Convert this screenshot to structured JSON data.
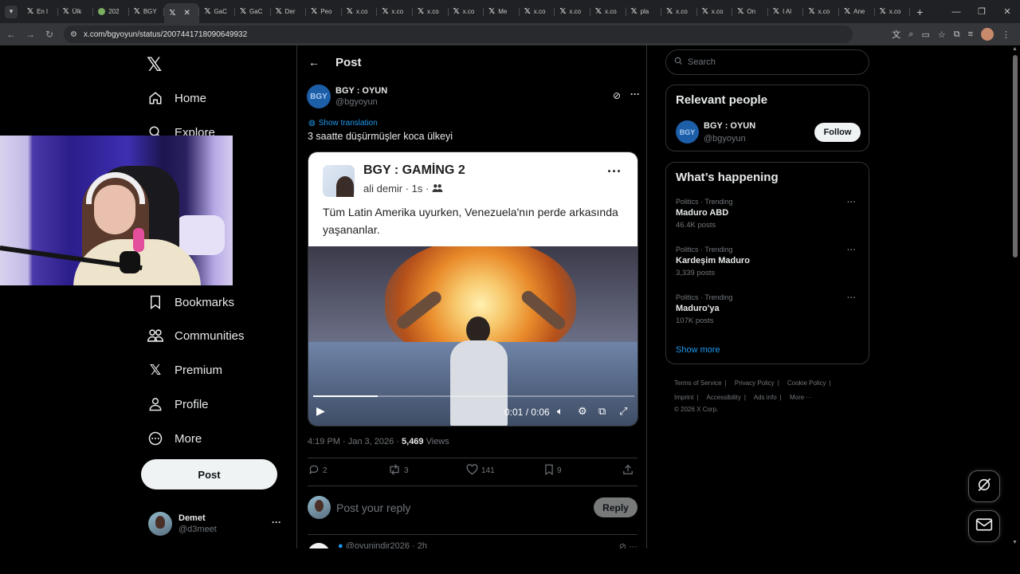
{
  "browser": {
    "tabs": [
      {
        "label": "En l",
        "icon": "x-icon"
      },
      {
        "label": "Ülk",
        "icon": "x-icon"
      },
      {
        "label": "202",
        "icon": "globe-icon"
      },
      {
        "label": "BGY",
        "icon": "x-icon"
      },
      {
        "label": "",
        "icon": "x-icon",
        "active": true
      },
      {
        "label": "GaC",
        "icon": "x-icon"
      },
      {
        "label": "GaC",
        "icon": "x-icon"
      },
      {
        "label": "Der",
        "icon": "x-icon"
      },
      {
        "label": "Peo",
        "icon": "x-icon"
      },
      {
        "label": "x.co",
        "icon": "x-icon"
      },
      {
        "label": "x.co",
        "icon": "x-icon"
      },
      {
        "label": "x.co",
        "icon": "x-icon"
      },
      {
        "label": "x.co",
        "icon": "x-icon"
      },
      {
        "label": "Me",
        "icon": "x-icon"
      },
      {
        "label": "x.co",
        "icon": "x-icon"
      },
      {
        "label": "x.co",
        "icon": "x-icon"
      },
      {
        "label": "x.co",
        "icon": "x-icon"
      },
      {
        "label": "pla",
        "icon": "x-icon"
      },
      {
        "label": "x.co",
        "icon": "x-icon"
      },
      {
        "label": "x.co",
        "icon": "x-icon"
      },
      {
        "label": "On",
        "icon": "x-icon"
      },
      {
        "label": "I Al",
        "icon": "x-icon"
      },
      {
        "label": "x.co",
        "icon": "x-icon"
      },
      {
        "label": "Ane",
        "icon": "x-icon"
      },
      {
        "label": "x.co",
        "icon": "x-icon"
      }
    ],
    "url": "x.com/bgyoyun/status/2007441718090649932"
  },
  "nav": {
    "items": [
      {
        "label": "Home",
        "icon": "home-icon"
      },
      {
        "label": "Explore",
        "icon": "search-icon"
      },
      {
        "label": "ns",
        "icon": "bell-icon"
      },
      {
        "label": "Bookmarks",
        "icon": "bookmark-icon"
      },
      {
        "label": "Communities",
        "icon": "communities-icon"
      },
      {
        "label": "Premium",
        "icon": "x-premium-icon"
      },
      {
        "label": "Profile",
        "icon": "person-icon"
      },
      {
        "label": "More",
        "icon": "more-circle-icon"
      }
    ],
    "post_label": "Post",
    "me": {
      "name": "Demet",
      "handle": "@d3meet"
    }
  },
  "main": {
    "header_title": "Post",
    "author": {
      "name": "BGY : OYUN",
      "handle": "@bgyoyun",
      "avatar_text": "BGY"
    },
    "show_translation": "Show translation",
    "text": "3 saatte düşürmüşler koca ülkeyi",
    "card": {
      "name": "BGY : GAMİNG 2",
      "meta": "ali demir · 1s ·",
      "text": "Tüm Latin Amerika uyurken, Venezuela'nın perde arkasında yaşananlar."
    },
    "video": {
      "time": "0:01 / 0:06",
      "progress": 0.2
    },
    "meta_time": "4:19 PM · Jan 3, 2026 ·",
    "views_count": "5,469",
    "views_label": "Views",
    "actions": {
      "replies": "2",
      "reposts": "3",
      "likes": "141",
      "bookmarks": "9"
    },
    "reply_placeholder": "Post your reply",
    "reply_button": "Reply",
    "next_post": {
      "handle": "@oyunindir2026 · 2h"
    }
  },
  "right": {
    "search_placeholder": "Search",
    "relevant_title": "Relevant people",
    "relevant_person": {
      "name": "BGY : OYUN",
      "handle": "@bgyoyun",
      "avatar_text": "BGY",
      "follow": "Follow"
    },
    "happening_title": "What’s happening",
    "trends": [
      {
        "category": "Politics · Trending",
        "name": "Maduro ABD",
        "count": "46.4K posts"
      },
      {
        "category": "Politics · Trending",
        "name": "Kardeşim Maduro",
        "count": "3,339 posts"
      },
      {
        "category": "Politics · Trending",
        "name": "Maduro'ya",
        "count": "107K posts"
      }
    ],
    "show_more": "Show more",
    "footer": {
      "links_row1": [
        "Terms of Service",
        "Privacy Policy",
        "Cookie Policy"
      ],
      "links_row2": [
        "Imprint",
        "Accessibility",
        "Ads info",
        "More ···"
      ],
      "copyright": "© 2026 X Corp."
    }
  },
  "colors": {
    "accent": "#1d9bf0",
    "background": "#000000",
    "border": "#2f3336",
    "muted": "#71767b"
  }
}
